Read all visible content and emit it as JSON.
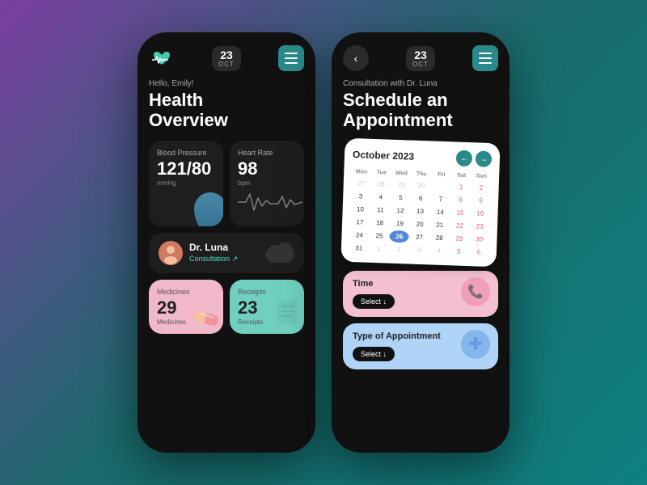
{
  "phone1": {
    "date": {
      "day": "23",
      "month": "OCT"
    },
    "greeting": "Hello, Emily!",
    "title_line1": "Health",
    "title_line2": "Overview",
    "blood_pressure": {
      "label": "Blood Pressure",
      "value": "121/80",
      "unit": "mmHg"
    },
    "heart_rate": {
      "label": "Heart Rate",
      "value": "98",
      "unit": "bpm"
    },
    "doctor": {
      "name": "Dr. Luna",
      "link_label": "Consultation ↗"
    },
    "medicines": {
      "label": "Medicines",
      "value": "29",
      "unit": "Medicines"
    },
    "receipts": {
      "label": "Receipts",
      "value": "23",
      "unit": "Receipts"
    }
  },
  "phone2": {
    "date": {
      "day": "23",
      "month": "OCT"
    },
    "greeting": "Consultation with Dr. Luna",
    "title_line1": "Schedule an",
    "title_line2": "Appointment",
    "calendar": {
      "month_year": "October 2023",
      "day_headers": [
        "Mon",
        "Tue",
        "Wed",
        "Thu",
        "Fri",
        "Sat",
        "Sun"
      ],
      "weeks": [
        [
          "27",
          "28",
          "29",
          "30",
          "",
          "1",
          "2"
        ],
        [
          "3",
          "4",
          "5",
          "6",
          "7",
          "8",
          "9"
        ],
        [
          "10",
          "11",
          "12",
          "13",
          "14",
          "15",
          "16"
        ],
        [
          "17",
          "18",
          "19",
          "20",
          "21",
          "22",
          "23"
        ],
        [
          "24",
          "25",
          "26",
          "27",
          "28",
          "29",
          "30"
        ],
        [
          "31",
          "1",
          "2",
          "3",
          "4",
          "5",
          "6"
        ]
      ],
      "today_date": "26",
      "other_month_start": [
        "27",
        "28",
        "29",
        "30"
      ],
      "other_month_end": [
        "1",
        "2",
        "3",
        "4",
        "5",
        "6"
      ]
    },
    "time_section": {
      "title": "Time",
      "select_label": "Select ↓"
    },
    "appointment_section": {
      "title": "Type of Appointment",
      "select_label": "Select ↓"
    }
  },
  "icons": {
    "heart_monitor": "♥",
    "menu": "≡",
    "back": "‹",
    "nav_prev": "←",
    "nav_next": "→",
    "pill": "💊",
    "receipt": "📋",
    "phone_call": "📞",
    "medical_cross": "+"
  }
}
